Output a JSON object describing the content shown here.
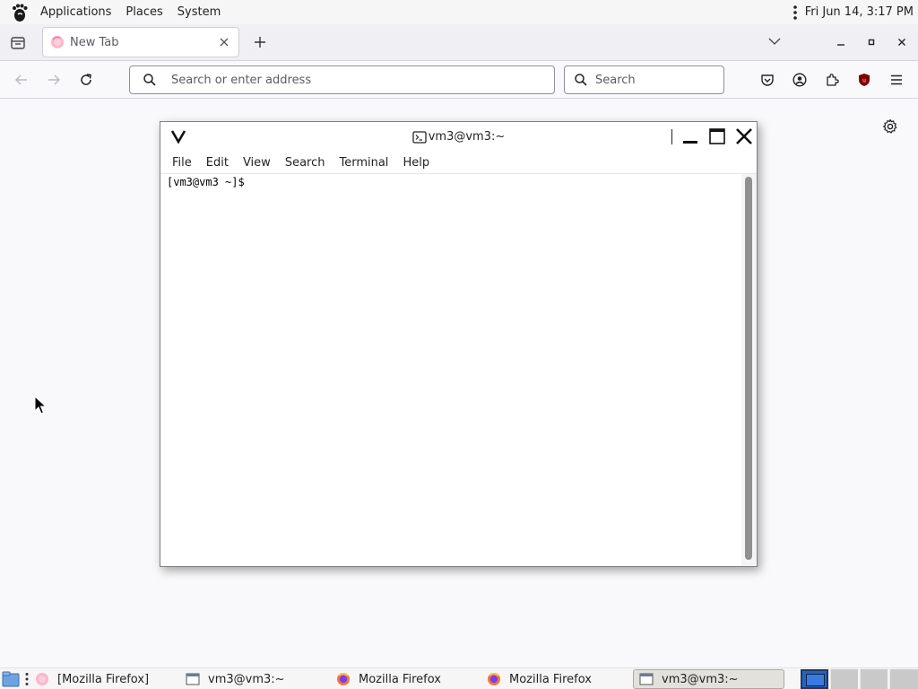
{
  "top_panel": {
    "menus": [
      "Applications",
      "Places",
      "System"
    ],
    "clock": "Fri Jun 14,  3:17 PM"
  },
  "browser": {
    "tabs": [
      {
        "title": "New Tab",
        "icon": "firefox-icon",
        "active": true
      }
    ],
    "url_bar": {
      "value": "",
      "placeholder": "Search or enter address"
    },
    "search_bar": {
      "value": "",
      "placeholder": "Search"
    },
    "toolbar_icons": [
      "back-icon",
      "forward-icon",
      "reload-icon",
      "pocket-icon",
      "account-icon",
      "extensions-icon",
      "ublock-icon",
      "menu-icon"
    ]
  },
  "terminal": {
    "title": "vm3@vm3:~",
    "menu": [
      "File",
      "Edit",
      "View",
      "Search",
      "Terminal",
      "Help"
    ],
    "prompt": "[vm3@vm3 ~]$ "
  },
  "taskbar": {
    "tasks": [
      {
        "label": "[Mozilla Firefox]",
        "icon": "firefox-icon",
        "active": false
      },
      {
        "label": "vm3@vm3:~",
        "icon": "terminal-window-icon",
        "active": false
      },
      {
        "label": "Mozilla Firefox",
        "icon": "firefox-icon",
        "active": false
      },
      {
        "label": "Mozilla Firefox",
        "icon": "firefox-icon",
        "active": false
      },
      {
        "label": "vm3@vm3:~",
        "icon": "terminal-window-icon",
        "active": true
      }
    ],
    "workspaces": [
      {
        "active": true
      },
      {
        "active": false
      },
      {
        "active": false
      },
      {
        "active": false
      }
    ]
  },
  "colors": {
    "accent": "#2a62b7",
    "ublock_red": "#800000",
    "firefox_orange": "#ff7139"
  }
}
